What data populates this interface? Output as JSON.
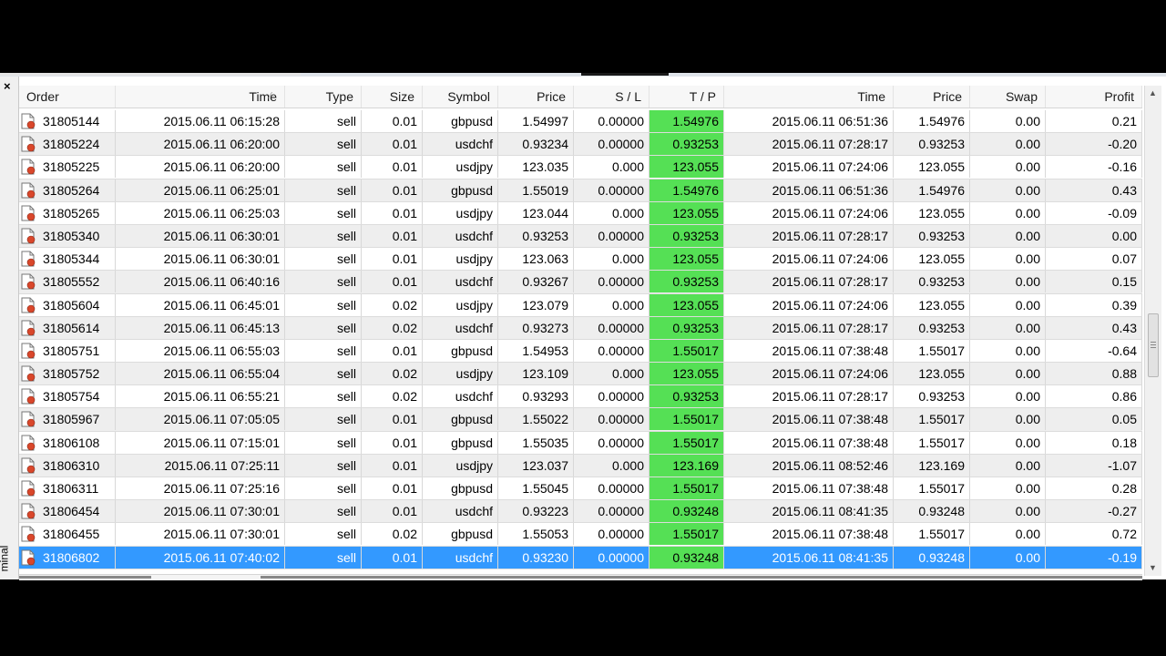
{
  "side_label": "minal",
  "columns": [
    "Order",
    "Time",
    "Type",
    "Size",
    "Symbol",
    "Price",
    "S / L",
    "T / P",
    "Time",
    "Price",
    "Swap",
    "Profit"
  ],
  "rows": [
    {
      "order": "31805144",
      "open_time": "2015.06.11 06:15:28",
      "type": "sell",
      "size": "0.01",
      "symbol": "gbpusd",
      "price": "1.54997",
      "sl": "0.00000",
      "tp": "1.54976",
      "close_time": "2015.06.11 06:51:36",
      "close_price": "1.54976",
      "swap": "0.00",
      "profit": "0.21"
    },
    {
      "order": "31805224",
      "open_time": "2015.06.11 06:20:00",
      "type": "sell",
      "size": "0.01",
      "symbol": "usdchf",
      "price": "0.93234",
      "sl": "0.00000",
      "tp": "0.93253",
      "close_time": "2015.06.11 07:28:17",
      "close_price": "0.93253",
      "swap": "0.00",
      "profit": "-0.20"
    },
    {
      "order": "31805225",
      "open_time": "2015.06.11 06:20:00",
      "type": "sell",
      "size": "0.01",
      "symbol": "usdjpy",
      "price": "123.035",
      "sl": "0.000",
      "tp": "123.055",
      "close_time": "2015.06.11 07:24:06",
      "close_price": "123.055",
      "swap": "0.00",
      "profit": "-0.16"
    },
    {
      "order": "31805264",
      "open_time": "2015.06.11 06:25:01",
      "type": "sell",
      "size": "0.01",
      "symbol": "gbpusd",
      "price": "1.55019",
      "sl": "0.00000",
      "tp": "1.54976",
      "close_time": "2015.06.11 06:51:36",
      "close_price": "1.54976",
      "swap": "0.00",
      "profit": "0.43"
    },
    {
      "order": "31805265",
      "open_time": "2015.06.11 06:25:03",
      "type": "sell",
      "size": "0.01",
      "symbol": "usdjpy",
      "price": "123.044",
      "sl": "0.000",
      "tp": "123.055",
      "close_time": "2015.06.11 07:24:06",
      "close_price": "123.055",
      "swap": "0.00",
      "profit": "-0.09"
    },
    {
      "order": "31805340",
      "open_time": "2015.06.11 06:30:01",
      "type": "sell",
      "size": "0.01",
      "symbol": "usdchf",
      "price": "0.93253",
      "sl": "0.00000",
      "tp": "0.93253",
      "close_time": "2015.06.11 07:28:17",
      "close_price": "0.93253",
      "swap": "0.00",
      "profit": "0.00"
    },
    {
      "order": "31805344",
      "open_time": "2015.06.11 06:30:01",
      "type": "sell",
      "size": "0.01",
      "symbol": "usdjpy",
      "price": "123.063",
      "sl": "0.000",
      "tp": "123.055",
      "close_time": "2015.06.11 07:24:06",
      "close_price": "123.055",
      "swap": "0.00",
      "profit": "0.07"
    },
    {
      "order": "31805552",
      "open_time": "2015.06.11 06:40:16",
      "type": "sell",
      "size": "0.01",
      "symbol": "usdchf",
      "price": "0.93267",
      "sl": "0.00000",
      "tp": "0.93253",
      "close_time": "2015.06.11 07:28:17",
      "close_price": "0.93253",
      "swap": "0.00",
      "profit": "0.15"
    },
    {
      "order": "31805604",
      "open_time": "2015.06.11 06:45:01",
      "type": "sell",
      "size": "0.02",
      "symbol": "usdjpy",
      "price": "123.079",
      "sl": "0.000",
      "tp": "123.055",
      "close_time": "2015.06.11 07:24:06",
      "close_price": "123.055",
      "swap": "0.00",
      "profit": "0.39"
    },
    {
      "order": "31805614",
      "open_time": "2015.06.11 06:45:13",
      "type": "sell",
      "size": "0.02",
      "symbol": "usdchf",
      "price": "0.93273",
      "sl": "0.00000",
      "tp": "0.93253",
      "close_time": "2015.06.11 07:28:17",
      "close_price": "0.93253",
      "swap": "0.00",
      "profit": "0.43"
    },
    {
      "order": "31805751",
      "open_time": "2015.06.11 06:55:03",
      "type": "sell",
      "size": "0.01",
      "symbol": "gbpusd",
      "price": "1.54953",
      "sl": "0.00000",
      "tp": "1.55017",
      "close_time": "2015.06.11 07:38:48",
      "close_price": "1.55017",
      "swap": "0.00",
      "profit": "-0.64"
    },
    {
      "order": "31805752",
      "open_time": "2015.06.11 06:55:04",
      "type": "sell",
      "size": "0.02",
      "symbol": "usdjpy",
      "price": "123.109",
      "sl": "0.000",
      "tp": "123.055",
      "close_time": "2015.06.11 07:24:06",
      "close_price": "123.055",
      "swap": "0.00",
      "profit": "0.88"
    },
    {
      "order": "31805754",
      "open_time": "2015.06.11 06:55:21",
      "type": "sell",
      "size": "0.02",
      "symbol": "usdchf",
      "price": "0.93293",
      "sl": "0.00000",
      "tp": "0.93253",
      "close_time": "2015.06.11 07:28:17",
      "close_price": "0.93253",
      "swap": "0.00",
      "profit": "0.86"
    },
    {
      "order": "31805967",
      "open_time": "2015.06.11 07:05:05",
      "type": "sell",
      "size": "0.01",
      "symbol": "gbpusd",
      "price": "1.55022",
      "sl": "0.00000",
      "tp": "1.55017",
      "close_time": "2015.06.11 07:38:48",
      "close_price": "1.55017",
      "swap": "0.00",
      "profit": "0.05"
    },
    {
      "order": "31806108",
      "open_time": "2015.06.11 07:15:01",
      "type": "sell",
      "size": "0.01",
      "symbol": "gbpusd",
      "price": "1.55035",
      "sl": "0.00000",
      "tp": "1.55017",
      "close_time": "2015.06.11 07:38:48",
      "close_price": "1.55017",
      "swap": "0.00",
      "profit": "0.18"
    },
    {
      "order": "31806310",
      "open_time": "2015.06.11 07:25:11",
      "type": "sell",
      "size": "0.01",
      "symbol": "usdjpy",
      "price": "123.037",
      "sl": "0.000",
      "tp": "123.169",
      "close_time": "2015.06.11 08:52:46",
      "close_price": "123.169",
      "swap": "0.00",
      "profit": "-1.07"
    },
    {
      "order": "31806311",
      "open_time": "2015.06.11 07:25:16",
      "type": "sell",
      "size": "0.01",
      "symbol": "gbpusd",
      "price": "1.55045",
      "sl": "0.00000",
      "tp": "1.55017",
      "close_time": "2015.06.11 07:38:48",
      "close_price": "1.55017",
      "swap": "0.00",
      "profit": "0.28"
    },
    {
      "order": "31806454",
      "open_time": "2015.06.11 07:30:01",
      "type": "sell",
      "size": "0.01",
      "symbol": "usdchf",
      "price": "0.93223",
      "sl": "0.00000",
      "tp": "0.93248",
      "close_time": "2015.06.11 08:41:35",
      "close_price": "0.93248",
      "swap": "0.00",
      "profit": "-0.27"
    },
    {
      "order": "31806455",
      "open_time": "2015.06.11 07:30:01",
      "type": "sell",
      "size": "0.02",
      "symbol": "gbpusd",
      "price": "1.55053",
      "sl": "0.00000",
      "tp": "1.55017",
      "close_time": "2015.06.11 07:38:48",
      "close_price": "1.55017",
      "swap": "0.00",
      "profit": "0.72"
    },
    {
      "order": "31806802",
      "open_time": "2015.06.11 07:40:02",
      "type": "sell",
      "size": "0.01",
      "symbol": "usdchf",
      "price": "0.93230",
      "sl": "0.00000",
      "tp": "0.93248",
      "close_time": "2015.06.11 08:41:35",
      "close_price": "0.93248",
      "swap": "0.00",
      "profit": "-0.19",
      "selected": true
    }
  ],
  "colors": {
    "tp_highlight": "#55e055",
    "selected_row": "#3399ff",
    "alt_row": "#eeeeee"
  },
  "icons": {
    "close": "close-icon",
    "order": "order-document-icon",
    "sort": "sort-indicator-icon"
  }
}
